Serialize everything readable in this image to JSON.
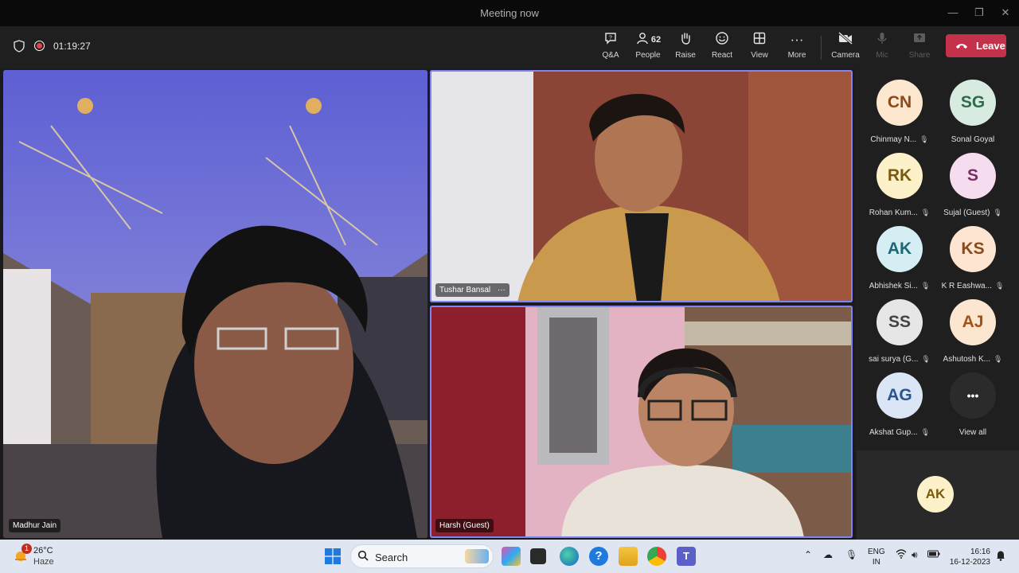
{
  "window": {
    "title": "Meeting now"
  },
  "meeting": {
    "timer": "01:19:27",
    "leave_label": "Leave",
    "toolbar": [
      {
        "key": "qa",
        "label": "Q&A",
        "icon": "qa-icon",
        "disabled": false
      },
      {
        "key": "people",
        "label": "People",
        "icon": "people-icon",
        "count": "62",
        "disabled": false
      },
      {
        "key": "raise",
        "label": "Raise",
        "icon": "raise-hand-icon",
        "disabled": false
      },
      {
        "key": "react",
        "label": "React",
        "icon": "react-smiley-icon",
        "disabled": false
      },
      {
        "key": "view",
        "label": "View",
        "icon": "view-grid-icon",
        "disabled": false
      },
      {
        "key": "more",
        "label": "More",
        "icon": "more-icon",
        "disabled": false
      },
      {
        "key": "camera",
        "label": "Camera",
        "icon": "camera-off-icon",
        "disabled": false
      },
      {
        "key": "mic",
        "label": "Mic",
        "icon": "mic-icon",
        "disabled": true
      },
      {
        "key": "share",
        "label": "Share",
        "icon": "share-icon",
        "disabled": true
      }
    ]
  },
  "videos": [
    {
      "name": "Madhur Jain"
    },
    {
      "name": "Tushar Bansal",
      "speaking": true
    },
    {
      "name": "Harsh (Guest)",
      "speaking": true
    }
  ],
  "participants": [
    {
      "initials": "CN",
      "name": "Chinmay N...",
      "muted": true,
      "bg": "#fde7cf",
      "fg": "#8a4a1a"
    },
    {
      "initials": "SG",
      "name": "Sonal Goyal",
      "muted": false,
      "bg": "#d7ebe0",
      "fg": "#2f6a4a"
    },
    {
      "initials": "RK",
      "name": "Rohan Kum...",
      "muted": true,
      "bg": "#fdf1c9",
      "fg": "#7a5a10"
    },
    {
      "initials": "S",
      "name": "Sujal (Guest)",
      "muted": true,
      "bg": "#f5dcef",
      "fg": "#7a2b63"
    },
    {
      "initials": "AK",
      "name": "Abhishek Si...",
      "muted": true,
      "bg": "#d5eef3",
      "fg": "#1d6674"
    },
    {
      "initials": "KS",
      "name": "K R Eashwa...",
      "muted": true,
      "bg": "#fde5d2",
      "fg": "#8a4a1a"
    },
    {
      "initials": "SS",
      "name": "sai surya (G...",
      "muted": true,
      "bg": "#e6e6e6",
      "fg": "#444444"
    },
    {
      "initials": "AJ",
      "name": "Ashutosh K...",
      "muted": true,
      "bg": "#fde6cf",
      "fg": "#a0521a"
    },
    {
      "initials": "AG",
      "name": "Akshat Gup...",
      "muted": true,
      "bg": "#dae6f5",
      "fg": "#2a5490"
    },
    {
      "initials": "•••",
      "name": "View all",
      "muted": false,
      "bg": "#2b2b2b",
      "fg": "#ffffff"
    }
  ],
  "self_view": {
    "initials": "AK",
    "bg": "#fdf1c9",
    "fg": "#7a5a10"
  },
  "taskbar": {
    "weather": {
      "temp": "26°C",
      "condition": "Haze",
      "badge": "1"
    },
    "search_label": "Search",
    "lang": {
      "line1": "ENG",
      "line2": "IN"
    },
    "clock": {
      "time": "16:16",
      "date": "16-12-2023"
    }
  }
}
